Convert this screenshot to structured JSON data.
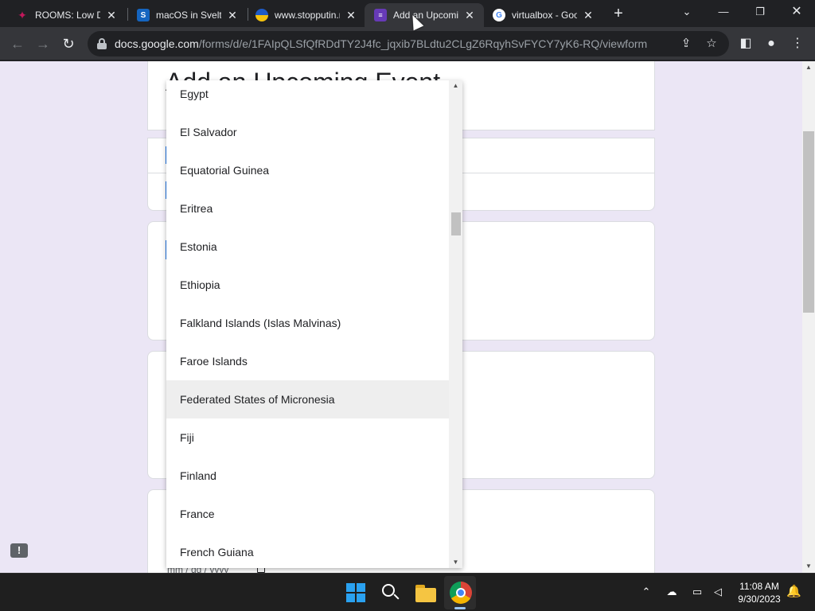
{
  "browser": {
    "tabs": [
      {
        "title": "ROOMS: Low De",
        "favicon": "rooms-favicon",
        "color": "#c2185b"
      },
      {
        "title": "macOS in Svelte",
        "favicon": "svelte-favicon",
        "color": "#1565c0"
      },
      {
        "title": "www.stopputin.n",
        "favicon": "ukraine-heart-favicon",
        "color": "#f4c20d"
      },
      {
        "title": "Add an Upcomi",
        "favicon": "google-forms-favicon",
        "color": "#673ab7",
        "active": true
      },
      {
        "title": "virtualbox - Goo",
        "favicon": "google-favicon",
        "color": "#4285f4"
      }
    ],
    "url_host": "docs.google.com",
    "url_path": "/forms/d/e/1FAIpQLSfQfRDdTY2J4fc_jqxib7BLdtu2CLgZ6RqyhSvFYCY7yK6-RQ/viewform"
  },
  "form": {
    "title": "Add an Upcoming Event",
    "date_placeholder": "mm / dd / yyyy"
  },
  "dropdown": {
    "items": [
      "Egypt",
      "El Salvador",
      "Equatorial Guinea",
      "Eritrea",
      "Estonia",
      "Ethiopia",
      "Falkland Islands (Islas Malvinas)",
      "Faroe Islands",
      "Federated States of Micronesia",
      "Fiji",
      "Finland",
      "France",
      "French Guiana"
    ],
    "hovered": "Federated States of Micronesia"
  },
  "taskbar": {
    "time": "11:08 AM",
    "date": "9/30/2023"
  },
  "colors": {
    "page_bg": "#ebe6f5",
    "accent": "#1a73e8",
    "hover_bg": "#eeeeee"
  }
}
